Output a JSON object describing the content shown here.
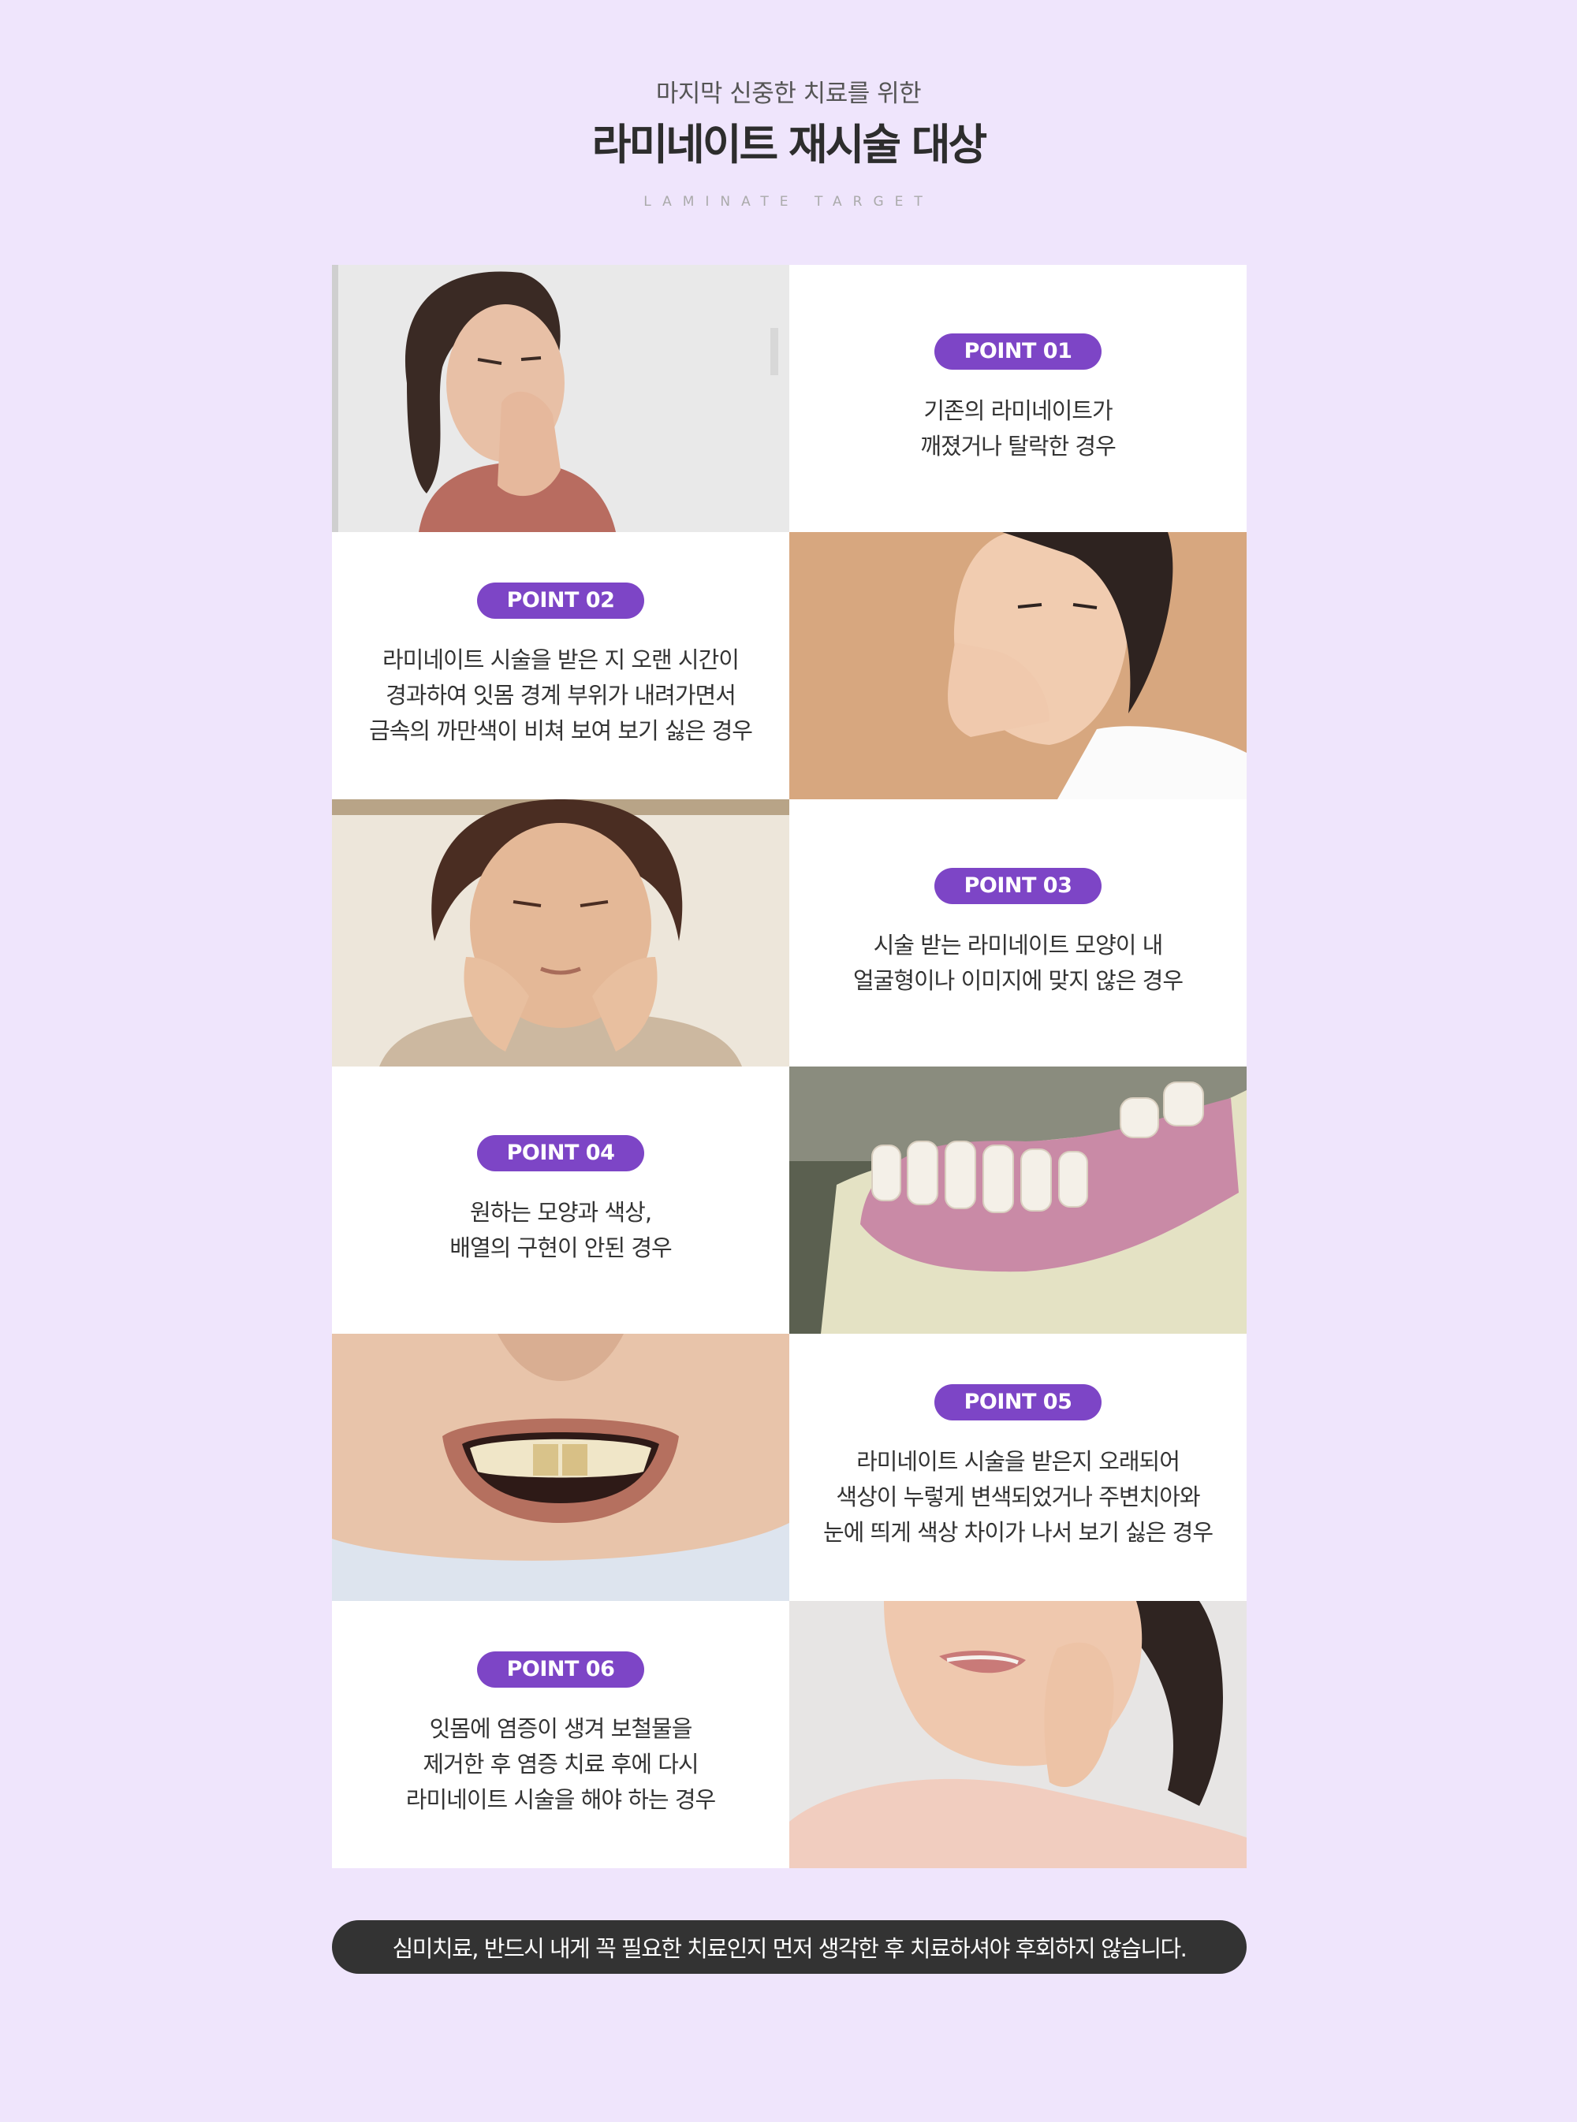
{
  "header": {
    "subtitle": "마지막 신중한 치료를 위한",
    "title": "라미네이트 재시술 대상",
    "english": "LAMINATE TARGET"
  },
  "points": [
    {
      "badge": "POINT 01",
      "lines": [
        "기존의 라미네이트가",
        "깨졌거나 탈락한 경우"
      ]
    },
    {
      "badge": "POINT 02",
      "lines": [
        "라미네이트 시술을 받은 지 오랜 시간이",
        "경과하여 잇몸 경계 부위가 내려가면서",
        "금속의 까만색이 비쳐 보여 보기 싫은 경우"
      ]
    },
    {
      "badge": "POINT 03",
      "lines": [
        "시술 받는 라미네이트 모양이 내",
        "얼굴형이나 이미지에 맞지 않은 경우"
      ]
    },
    {
      "badge": "POINT 04",
      "lines": [
        "원하는 모양과 색상,",
        "배열의 구현이 안된 경우"
      ]
    },
    {
      "badge": "POINT 05",
      "lines": [
        "라미네이트 시술을 받은지 오래되어",
        "색상이 누렇게 변색되었거나 주변치아와",
        "눈에 띄게 색상 차이가 나서 보기 싫은 경우"
      ]
    },
    {
      "badge": "POINT 06",
      "lines": [
        "잇몸에 염증이 생겨 보철물을",
        "제거한 후 염증 치료 후에 다시",
        "라미네이트 시술을 해야 하는 경우"
      ]
    }
  ],
  "footer": {
    "banner": "심미치료, 반드시 내게 꼭 필요한 치료인지 먼저 생각한 후 치료하셔야 후회하지 않습니다."
  },
  "colors": {
    "background": "#efe5fc",
    "badge": "#7d45c6",
    "banner": "#333333"
  }
}
